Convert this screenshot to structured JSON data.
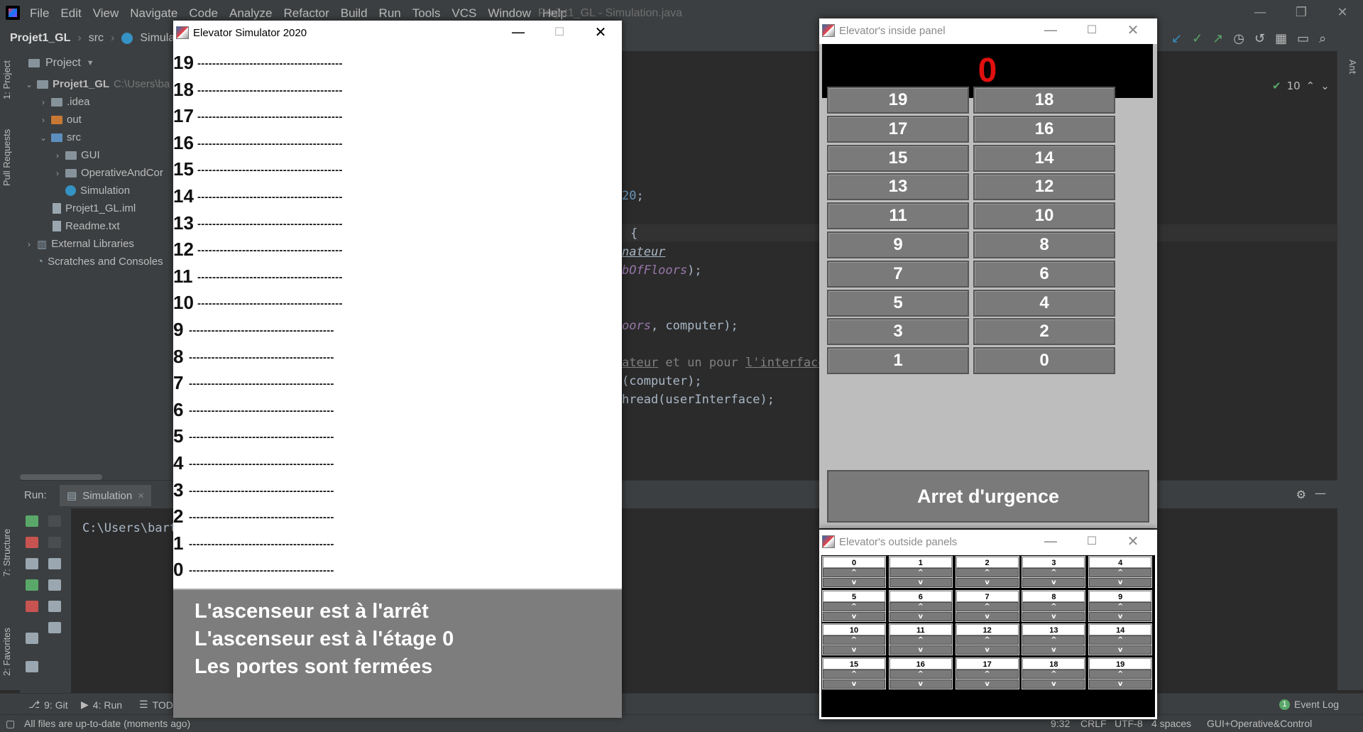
{
  "ide": {
    "menu": [
      "File",
      "Edit",
      "View",
      "Navigate",
      "Code",
      "Analyze",
      "Refactor",
      "Build",
      "Run",
      "Tools",
      "VCS",
      "Window",
      "Help"
    ],
    "window_title": "Projet1_GL - Simulation.java",
    "breadcrumb": [
      "Projet1_GL",
      "src",
      "Simulation"
    ],
    "left_tabs": [
      "1: Project",
      "Pull Requests",
      "7: Structure",
      "2: Favorites"
    ],
    "right_tab": "Ant",
    "project_panel_title": "Project",
    "tree": [
      {
        "label": "Projet1_GL",
        "extra": "C:\\Users\\ba"
      },
      {
        "label": ".idea"
      },
      {
        "label": "out"
      },
      {
        "label": "src"
      },
      {
        "label": "GUI"
      },
      {
        "label": "OperativeAndCor"
      },
      {
        "label": "Simulation"
      },
      {
        "label": "Projet1_GL.iml"
      },
      {
        "label": "Readme.txt"
      },
      {
        "label": "External Libraries"
      },
      {
        "label": "Scratches and Consoles"
      }
    ],
    "inspection_count": "10",
    "code": {
      "l1_num": "20",
      "l1_rest": ";",
      "l2": "{",
      "l3": "nateur",
      "l4_it": "bOfFloors",
      "l4_rest": ");",
      "l5_it": "oors",
      "l5_rest": ", computer);",
      "l6_a": "ateur",
      "l6_b": " et un pour ",
      "l6_c": "l'interface",
      "l7": "(computer);",
      "l8": "hread(userInterface);"
    },
    "run_label": "Run:",
    "run_tab": "Simulation",
    "console_line": "C:\\Users\\bart",
    "bottom_tabs": {
      "git": "9: Git",
      "run": "4: Run",
      "todo": "TODO"
    },
    "event_log": "Event Log",
    "event_count": "1",
    "status_left": "All files are up-to-date (moments ago)",
    "status_right": {
      "pos": "9:32",
      "crlf": "CRLF",
      "enc": "UTF-8",
      "indent": "4 spaces",
      "branch": "GUI+Operative&Control"
    }
  },
  "simulator": {
    "title": "Elevator Simulator 2020",
    "floors": [
      "19",
      "18",
      "17",
      "16",
      "15",
      "14",
      "13",
      "12",
      "11",
      "10",
      "9",
      "8",
      "7",
      "6",
      "5",
      "4",
      "3",
      "2",
      "1",
      "0"
    ],
    "dashes": "---------------------------------------",
    "status": {
      "state": "L'ascenseur est à l'arrêt",
      "floor": "L'ascenseur est à l'étage 0",
      "doors": "Les portes sont fermées"
    }
  },
  "inside_panel": {
    "title": "Elevator's inside panel",
    "display_value": "0",
    "buttons": [
      "19",
      "18",
      "17",
      "16",
      "15",
      "14",
      "13",
      "12",
      "11",
      "10",
      "9",
      "8",
      "7",
      "6",
      "5",
      "4",
      "3",
      "2",
      "1",
      "0"
    ],
    "emergency": "Arret d'urgence",
    "display_color": "#e01010"
  },
  "outside_panels": {
    "title": "Elevator's outside panels",
    "floors": [
      "0",
      "1",
      "2",
      "3",
      "4",
      "5",
      "6",
      "7",
      "8",
      "9",
      "10",
      "11",
      "12",
      "13",
      "14",
      "15",
      "16",
      "17",
      "18",
      "19"
    ],
    "up": "^",
    "down": "v"
  }
}
